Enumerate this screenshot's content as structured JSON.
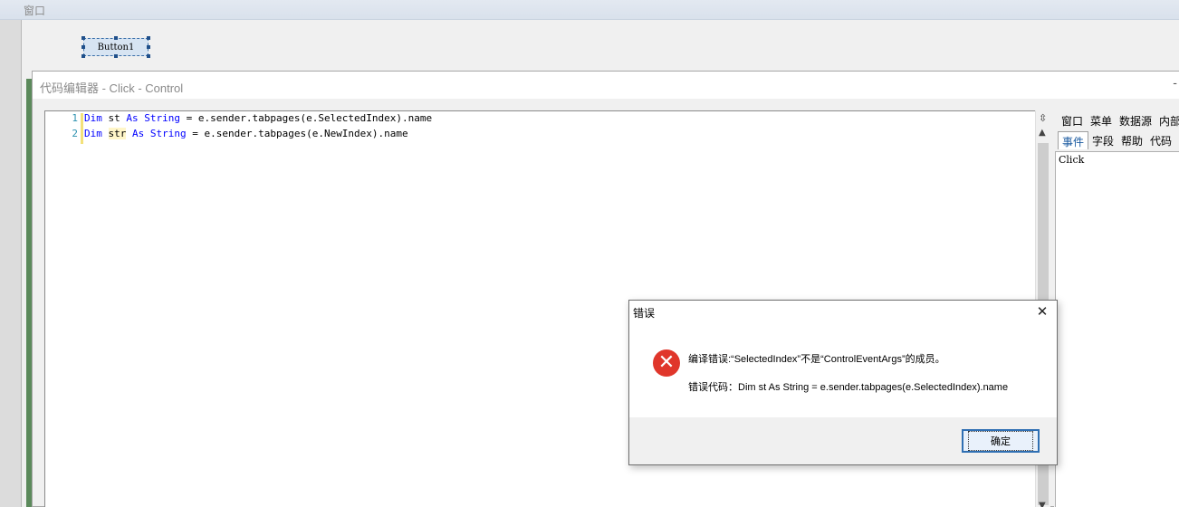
{
  "designer": {
    "title": "窗口",
    "button_label": "Button1"
  },
  "editor": {
    "title": "代码编辑器 - Click - Control",
    "minimize_glyph": "-",
    "lines": [
      {
        "number": "1",
        "parts": [
          "Dim",
          " st ",
          "As",
          " ",
          "String",
          " = e.sender.tabpages(e.SelectedIndex).name"
        ]
      },
      {
        "number": "2",
        "parts": [
          "Dim",
          " ",
          "str",
          " ",
          "As",
          " ",
          "String",
          " = e.sender.tabpages(e.NewIndex).name"
        ]
      }
    ]
  },
  "side_panel": {
    "tabs_row1": [
      "窗口",
      "菜单",
      "数据源",
      "内部"
    ],
    "tabs_row2": [
      "事件",
      "字段",
      "帮助",
      "代码"
    ],
    "active_tab": "事件",
    "events": [
      "Click"
    ]
  },
  "error_dialog": {
    "title": "错误",
    "close_glyph": "✕",
    "icon_glyph": "✕",
    "message_line1": "编译错误:“SelectedIndex”不是“ControlEventArgs”的成员。",
    "message_line2": "错误代码：Dim st As String = e.sender.tabpages(e.SelectedIndex).name",
    "ok_label": "确定"
  },
  "colors": {
    "keyword": "#0000ff",
    "line_number": "#2b91af",
    "error_icon": "#e0362b",
    "default_button_border": "#2f6fb3"
  }
}
